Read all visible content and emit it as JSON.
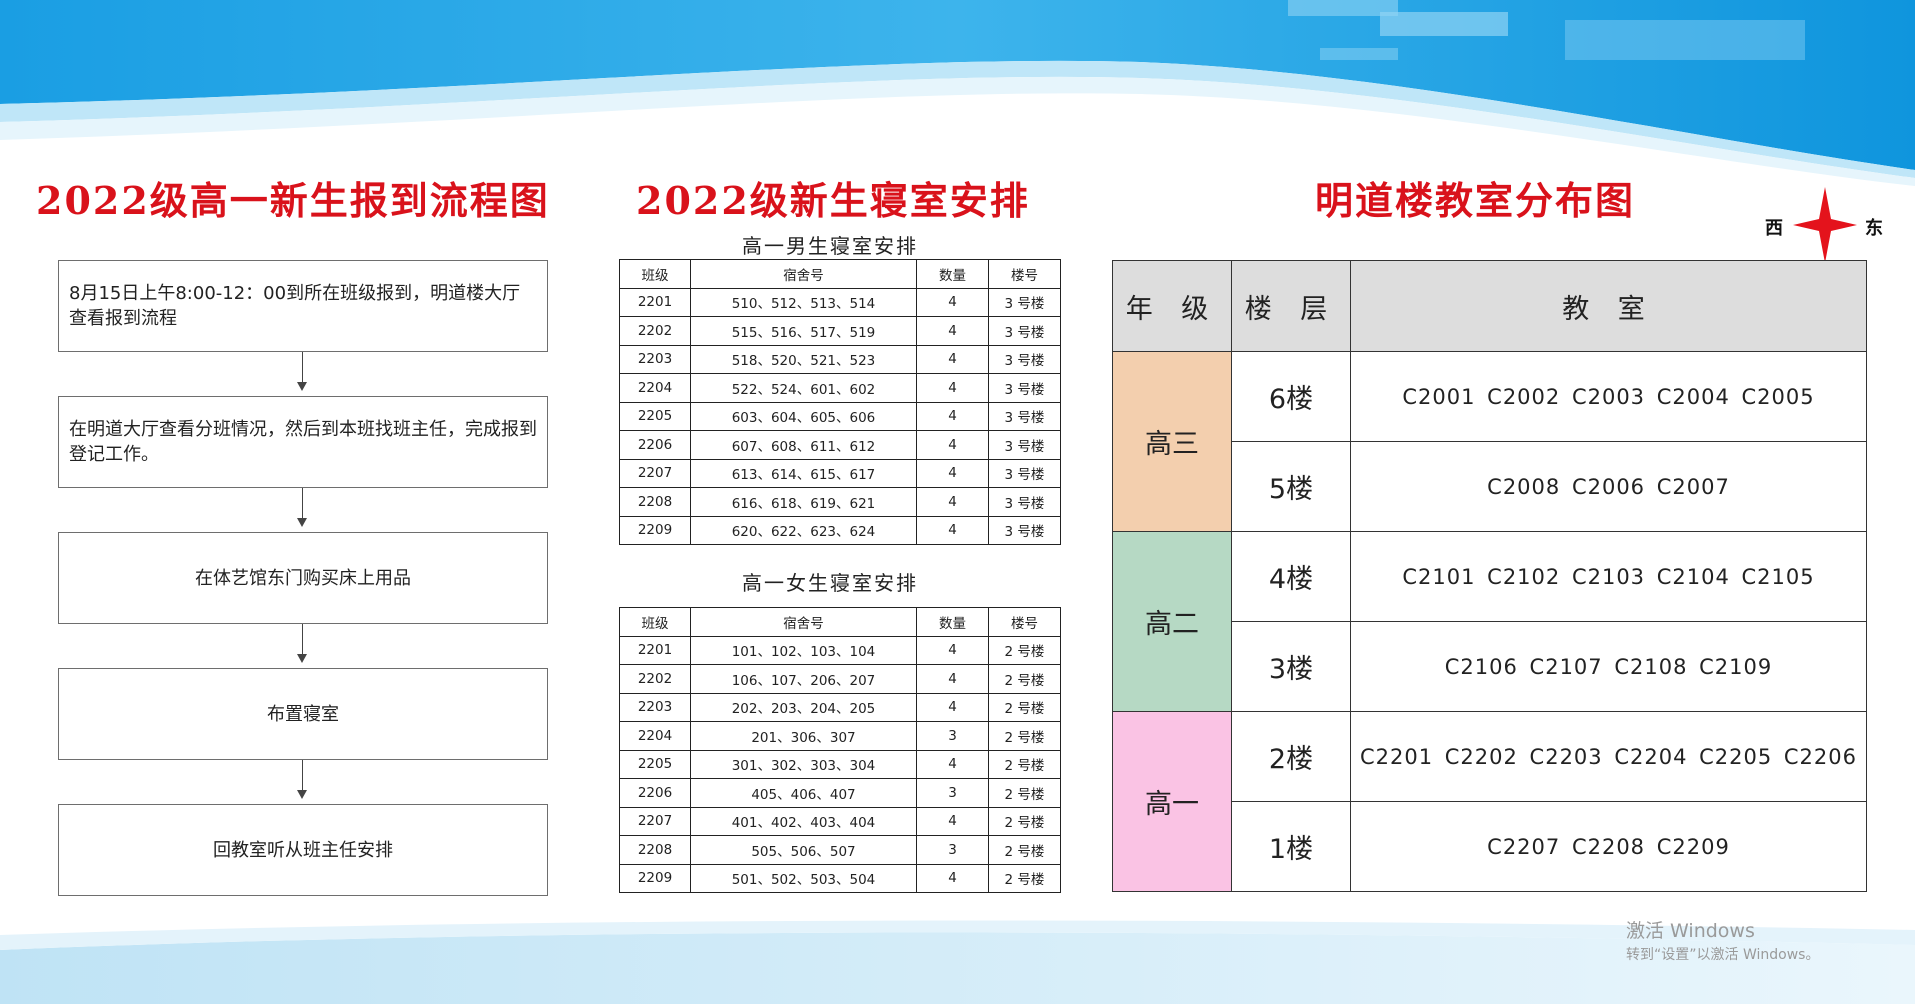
{
  "titles": {
    "flow": "2022级高一新生报到流程图",
    "dorm": "2022级新生寝室安排",
    "classroom": "明道楼教室分布图"
  },
  "flow_steps": [
    "8月15日上午8:00-12：00到所在班级报到，明道楼大厅查看报到流程",
    "在明道大厅查看分班情况，然后到本班找班主任，完成报到登记工作。",
    "在体艺馆东门购买床上用品",
    "布置寝室",
    "回教室听从班主任安排"
  ],
  "dorm_tables": {
    "headers": [
      "班级",
      "宿舍号",
      "数量",
      "楼号"
    ],
    "boys": {
      "title": "高一男生寝室安排",
      "rows": [
        [
          "2201",
          "510、512、513、514",
          "4",
          "3 号楼"
        ],
        [
          "2202",
          "515、516、517、519",
          "4",
          "3 号楼"
        ],
        [
          "2203",
          "518、520、521、523",
          "4",
          "3 号楼"
        ],
        [
          "2204",
          "522、524、601、602",
          "4",
          "3 号楼"
        ],
        [
          "2205",
          "603、604、605、606",
          "4",
          "3 号楼"
        ],
        [
          "2206",
          "607、608、611、612",
          "4",
          "3 号楼"
        ],
        [
          "2207",
          "613、614、615、617",
          "4",
          "3 号楼"
        ],
        [
          "2208",
          "616、618、619、621",
          "4",
          "3 号楼"
        ],
        [
          "2209",
          "620、622、623、624",
          "4",
          "3 号楼"
        ]
      ]
    },
    "girls": {
      "title": "高一女生寝室安排",
      "rows": [
        [
          "2201",
          "101、102、103、104",
          "4",
          "2 号楼"
        ],
        [
          "2202",
          "106、107、206、207",
          "4",
          "2 号楼"
        ],
        [
          "2203",
          "202、203、204、205",
          "4",
          "2 号楼"
        ],
        [
          "2204",
          "201、306、307",
          "3",
          "2 号楼"
        ],
        [
          "2205",
          "301、302、303、304",
          "4",
          "2 号楼"
        ],
        [
          "2206",
          "405、406、407",
          "3",
          "2 号楼"
        ],
        [
          "2207",
          "401、402、403、404",
          "4",
          "2 号楼"
        ],
        [
          "2208",
          "505、506、507",
          "3",
          "2 号楼"
        ],
        [
          "2209",
          "501、502、503、504",
          "4",
          "2 号楼"
        ]
      ]
    }
  },
  "compass": {
    "west": "西",
    "east": "东"
  },
  "classroom_table": {
    "headers": [
      "年 级",
      "楼 层",
      "教 室"
    ],
    "grades": [
      {
        "name": "高三",
        "color": "#f3cfae",
        "floors": [
          {
            "floor": "6楼",
            "rooms": "C2001 C2002 C2003 C2004 C2005"
          },
          {
            "floor": "5楼",
            "rooms": "C2008 C2006 C2007"
          }
        ]
      },
      {
        "name": "高二",
        "color": "#b6d9c4",
        "floors": [
          {
            "floor": "4楼",
            "rooms": "C2101 C2102 C2103 C2104 C2105"
          },
          {
            "floor": "3楼",
            "rooms": "C2106 C2107 C2108 C2109"
          }
        ]
      },
      {
        "name": "高一",
        "color": "#fac3e4",
        "floors": [
          {
            "floor": "2楼",
            "rooms": "C2201 C2202 C2203 C2204 C2205 C2206"
          },
          {
            "floor": "1楼",
            "rooms": "C2207 C2208 C2209"
          }
        ]
      }
    ]
  },
  "watermark": {
    "line1": "激活 Windows",
    "line2": "转到“设置”以激活 Windows。"
  },
  "colors": {
    "title_red": "#d9121b",
    "banner_blue": "#1ca3e6",
    "header_gray": "#dddddd"
  }
}
